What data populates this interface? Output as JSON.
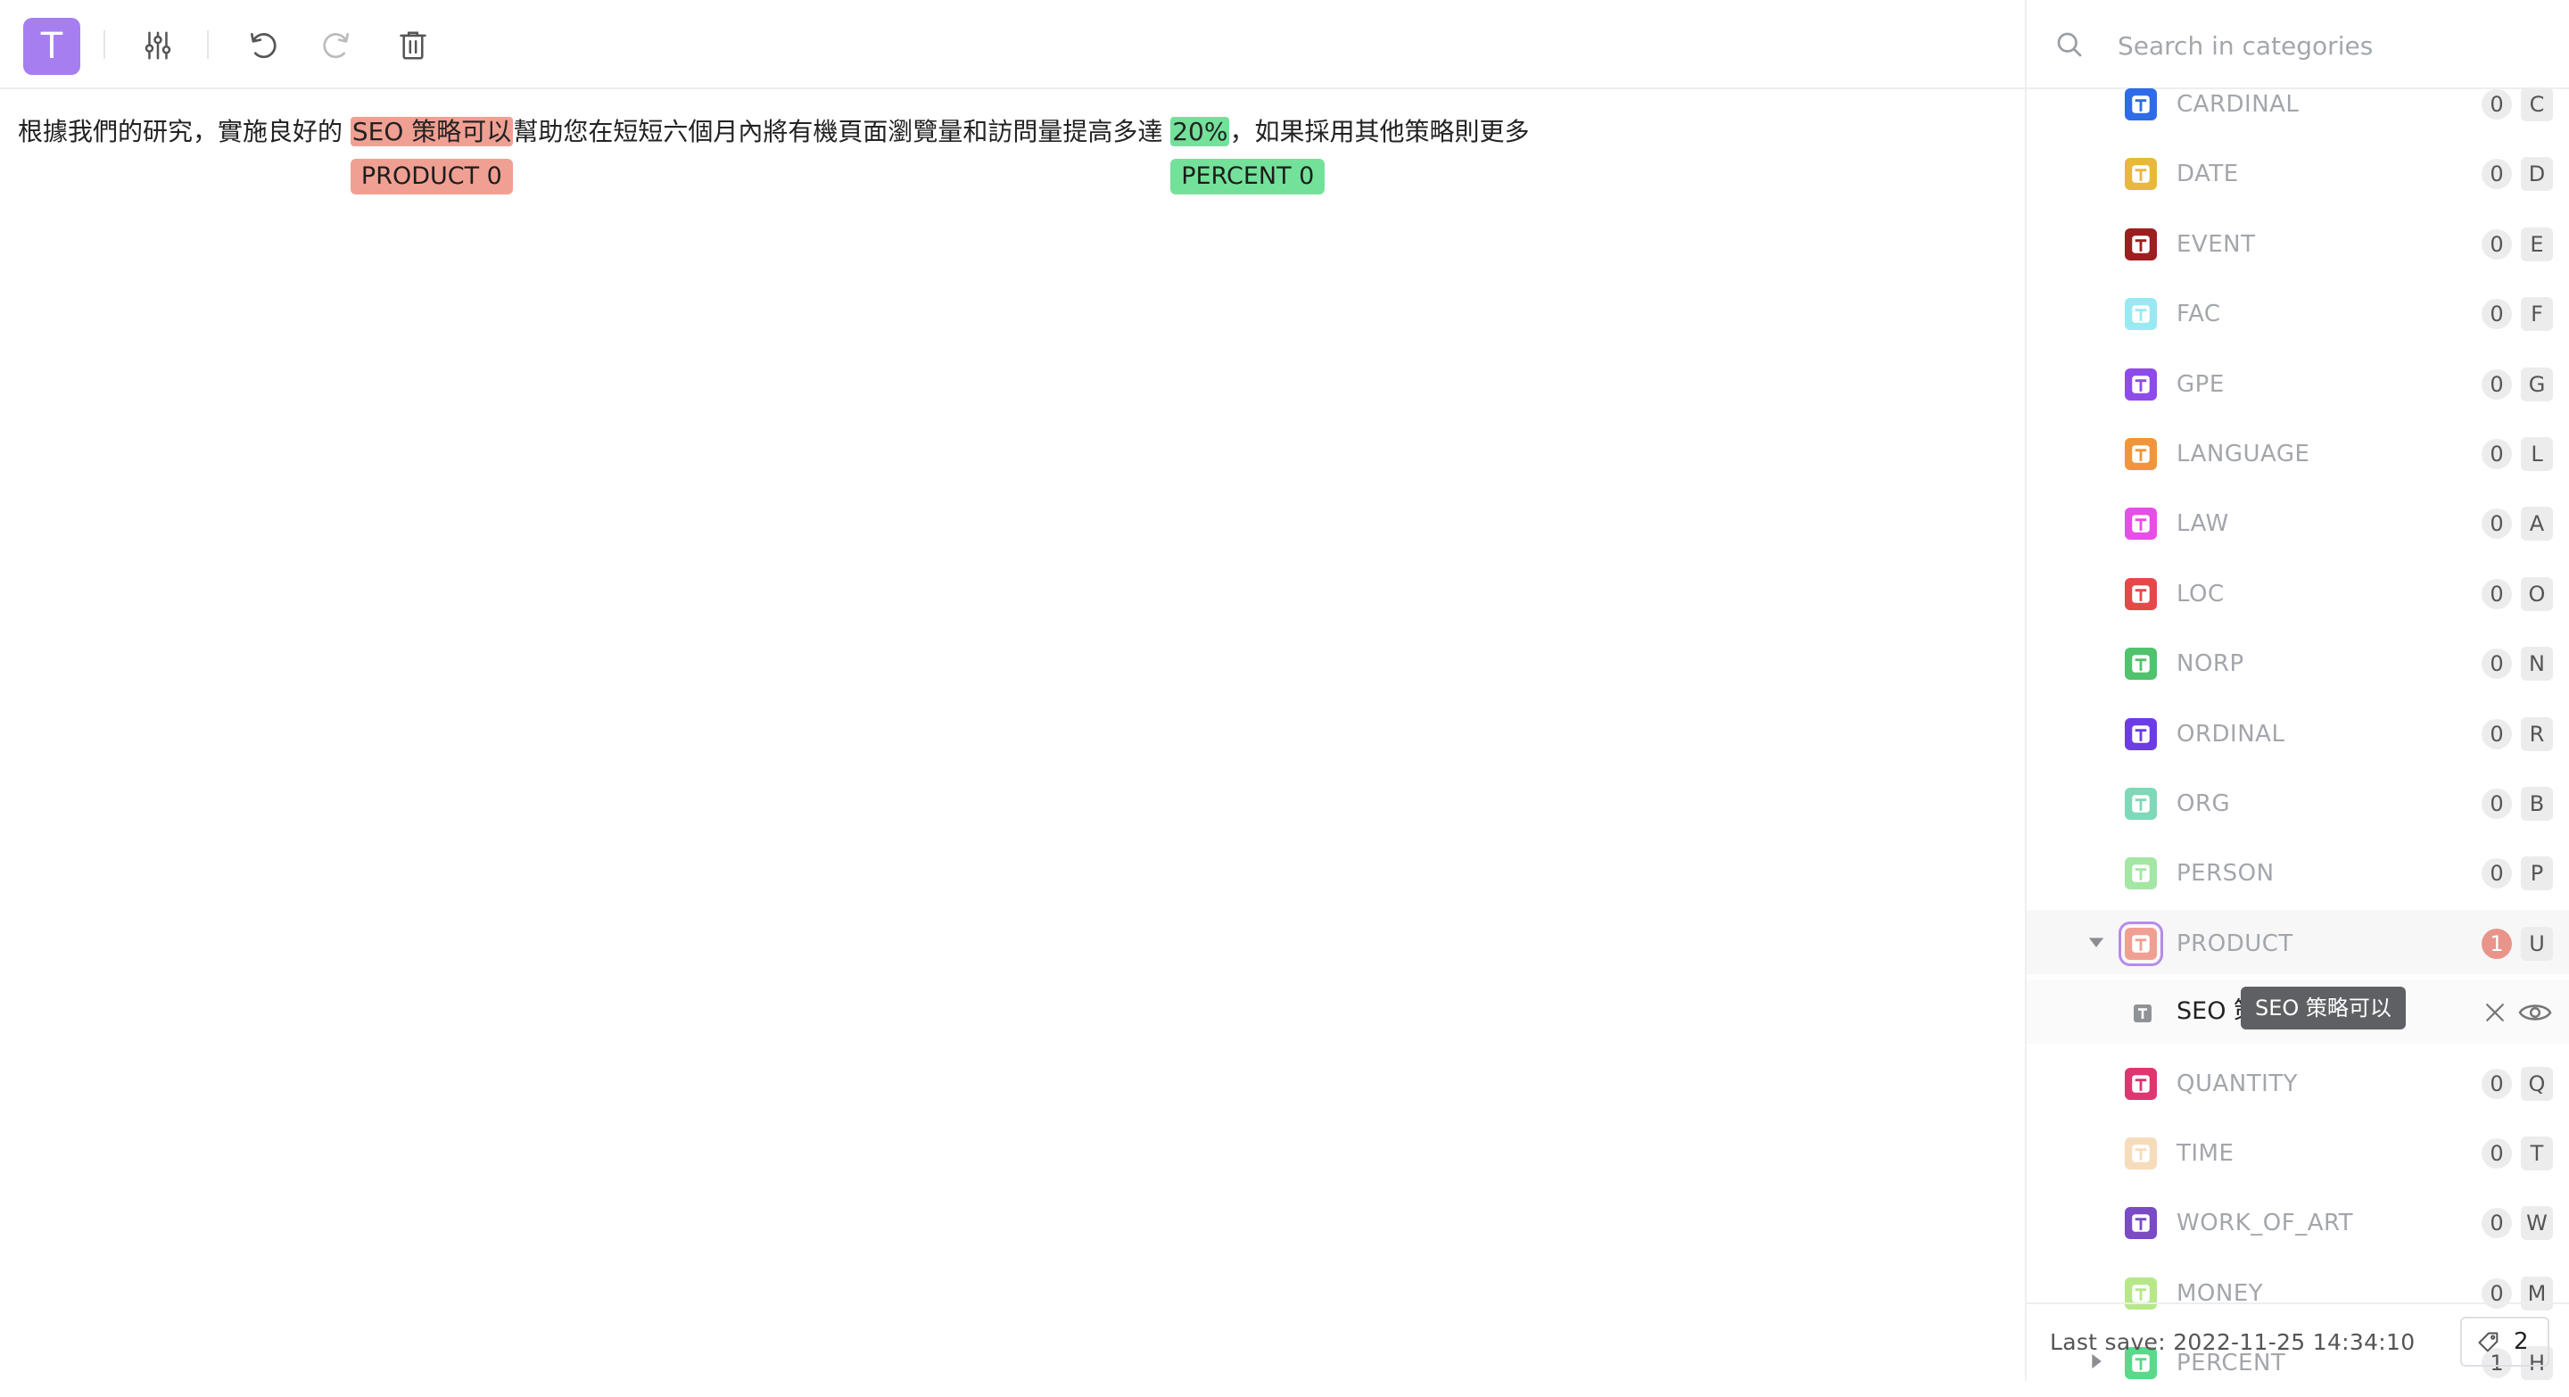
{
  "toolbar": {
    "logo_letter": "T",
    "logo_color": "#a67ef0"
  },
  "editor": {
    "text_before": "根據我們的研究，實施良好的 ",
    "entity1": {
      "text": "SEO 策略可以",
      "label": "PRODUCT 0",
      "color": "#f0a093"
    },
    "text_middle": "幫助您在短短六個月內將有機頁面瀏覽量和訪問量提高多達 ",
    "entity2": {
      "text": "20%",
      "label": "PERCENT 0",
      "color": "#74e19a"
    },
    "text_after": "，如果採用其他策略則更多"
  },
  "search": {
    "placeholder": "Search in categories"
  },
  "categories": [
    {
      "label": "CARDINAL",
      "count": "0",
      "key": "C",
      "color": "#2e6be6"
    },
    {
      "label": "DATE",
      "count": "0",
      "key": "D",
      "color": "#e8b83a"
    },
    {
      "label": "EVENT",
      "count": "0",
      "key": "E",
      "color": "#9c1e1e"
    },
    {
      "label": "FAC",
      "count": "0",
      "key": "F",
      "color": "#99e9f2"
    },
    {
      "label": "GPE",
      "count": "0",
      "key": "G",
      "color": "#8e4be8"
    },
    {
      "label": "LANGUAGE",
      "count": "0",
      "key": "L",
      "color": "#f0963a"
    },
    {
      "label": "LAW",
      "count": "0",
      "key": "A",
      "color": "#e64ee6"
    },
    {
      "label": "LOC",
      "count": "0",
      "key": "O",
      "color": "#e54848"
    },
    {
      "label": "NORP",
      "count": "0",
      "key": "N",
      "color": "#51c26d"
    },
    {
      "label": "ORDINAL",
      "count": "0",
      "key": "R",
      "color": "#6c3ce6"
    },
    {
      "label": "ORG",
      "count": "0",
      "key": "B",
      "color": "#7fd8b8"
    },
    {
      "label": "PERSON",
      "count": "0",
      "key": "P",
      "color": "#a4e6a4"
    },
    {
      "label": "PRODUCT",
      "count": "1",
      "key": "U",
      "color": "#f0a093",
      "expanded": true
    },
    {
      "label": "QUANTITY",
      "count": "0",
      "key": "Q",
      "color": "#e0356e"
    },
    {
      "label": "TIME",
      "count": "0",
      "key": "T",
      "color": "#f7dcbb"
    },
    {
      "label": "WORK_OF_ART",
      "count": "0",
      "key": "W",
      "color": "#7a4bc4"
    },
    {
      "label": "MONEY",
      "count": "0",
      "key": "M",
      "color": "#b6e88a"
    },
    {
      "label": "PERCENT",
      "count": "1",
      "key": "H",
      "color": "#5bd88a",
      "collapsed": true
    }
  ],
  "annotation": {
    "text": "SEO 策略可以"
  },
  "tooltip": {
    "text": "SEO 策略可以"
  },
  "footer": {
    "last_save": "Last save: 2022-11-25 14:34:10",
    "tag_count": "2"
  }
}
